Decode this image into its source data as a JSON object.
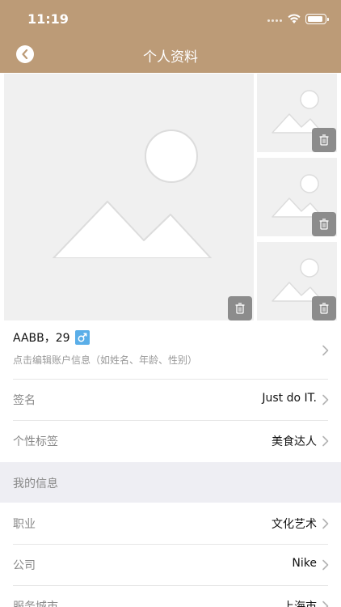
{
  "status_bar": {
    "time": "11:19"
  },
  "nav": {
    "title": "个人资料"
  },
  "profile": {
    "name_age": "AABB，29",
    "gender_icon": "male-icon",
    "hint": "点击编辑账户信息（如姓名、年龄、性别）"
  },
  "rows": {
    "signature": {
      "label": "签名",
      "value": "Just do IT."
    },
    "tags": {
      "label": "个性标签",
      "value": "美食达人"
    }
  },
  "section": {
    "title": "我的信息"
  },
  "info_rows": {
    "job": {
      "label": "职业",
      "value": "文化艺术"
    },
    "company": {
      "label": "公司",
      "value": "Nike"
    },
    "city": {
      "label": "服务城市",
      "value": "上海市"
    }
  },
  "colors": {
    "header": "#BC9B77",
    "gender_badge": "#5aaee8",
    "section_bg": "#eeeef3"
  }
}
